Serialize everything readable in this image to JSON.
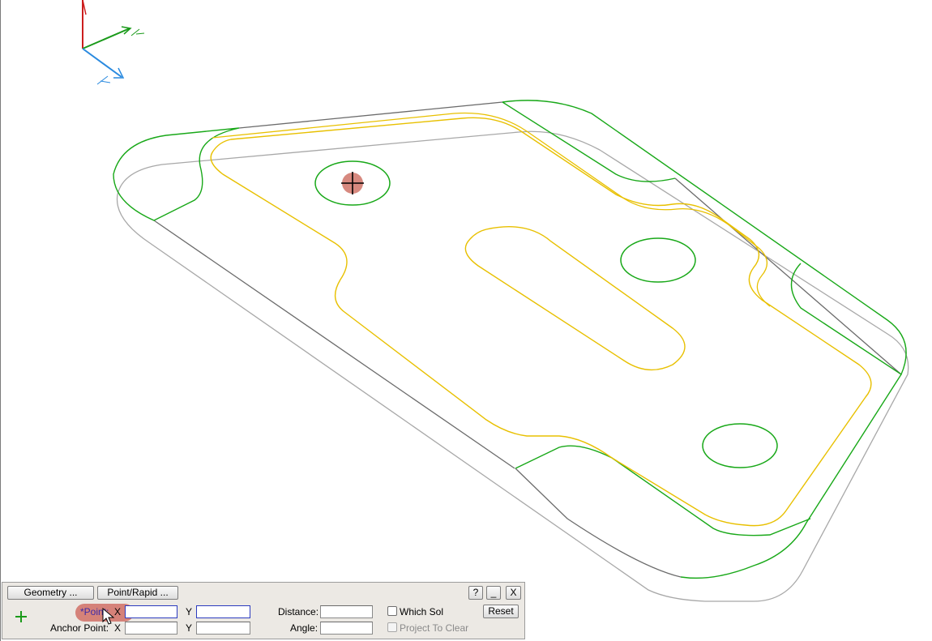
{
  "viewport": {
    "colors": {
      "edge_gray": "#a8a8a8",
      "edge_dark": "#6b6b6b",
      "contour_green": "#18a818",
      "contour_yellow": "#e8c000",
      "axis_red": "#cc1e1e",
      "axis_green": "#1a9a1a",
      "axis_blue": "#2a8adf",
      "cursor_marker": "#cd6b5f"
    },
    "cursor_icon": "crosshair-cursor-icon"
  },
  "panel": {
    "geometry_button": "Geometry ...",
    "point_rapid_button": "Point/Rapid ...",
    "help_button": "?",
    "minimize_button": "_",
    "close_button": "X",
    "point_label": "*Point:",
    "x_label": "X",
    "y_label": "Y",
    "anchor_label": "Anchor Point:",
    "distance_label": "Distance:",
    "angle_label": "Angle:",
    "which_sol_label": "Which Sol",
    "project_to_clear_label": "Project To Clear",
    "reset_button": "Reset",
    "point_x_value": "",
    "point_y_value": "",
    "anchor_x_value": "",
    "anchor_y_value": "",
    "distance_value": "",
    "angle_value": "",
    "pick_icon": "crosshair-pick-icon",
    "pointer_icon": "mouse-pointer-icon"
  }
}
